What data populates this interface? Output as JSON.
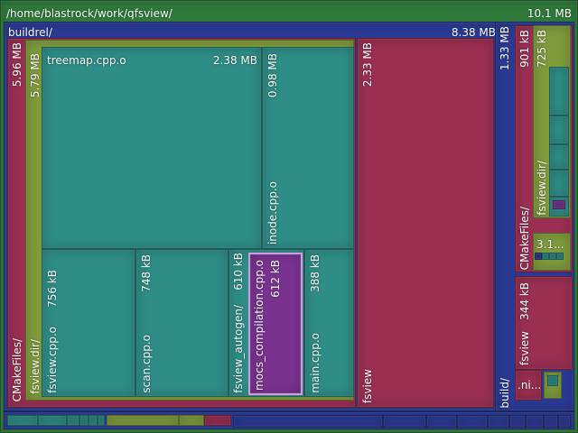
{
  "colors": {
    "green": "#7f9b3c",
    "teal": "#2e8d86",
    "crimson": "#9a2f52",
    "navy": "#2a3a94",
    "purple": "#7a3291",
    "frame": "#2f7a3b"
  },
  "root": {
    "path": "/home/blastrock/work/qfsview/",
    "size": "10.1 MB"
  },
  "buildrel": {
    "name": "buildrel/",
    "size": "8.38 MB"
  },
  "cmakefiles_a": {
    "name": "CMakeFiles/",
    "size": "5.96 MB"
  },
  "fsview_dir_a": {
    "name": "fsview.dir/",
    "size": "5.79 MB"
  },
  "treemap": {
    "name": "treemap.cpp.o",
    "size": "2.38 MB"
  },
  "inode": {
    "name": "inode.cpp.o",
    "size": "0.98 MB"
  },
  "fsview_cpp": {
    "name": "fsview.cpp.o",
    "size": "756 kB"
  },
  "scan_cpp": {
    "name": "scan.cpp.o",
    "size": "748 kB"
  },
  "fsview_autogen": {
    "name": "fsview_autogen/",
    "size": "610 kB"
  },
  "mocs": {
    "name": "mocs_compilation.cpp.o",
    "size": "612 kB"
  },
  "main_cpp": {
    "name": "main.cpp.o",
    "size": "388 kB"
  },
  "fsview_bin": {
    "name": "fsview",
    "size": "2.33 MB"
  },
  "build": {
    "name": "build/",
    "size": "1.33 MB"
  },
  "cmakefiles_b": {
    "name": "CMakeFiles/",
    "size": "901 kB"
  },
  "fsview_dir_b": {
    "name": "fsview.dir/",
    "size": "725 kB"
  },
  "small_item": {
    "name": "3.1..."
  },
  "fsview_bin_b": {
    "name": "fsview",
    "size": "344 kB"
  },
  "hidden_item": {
    "name": ".ni..."
  }
}
